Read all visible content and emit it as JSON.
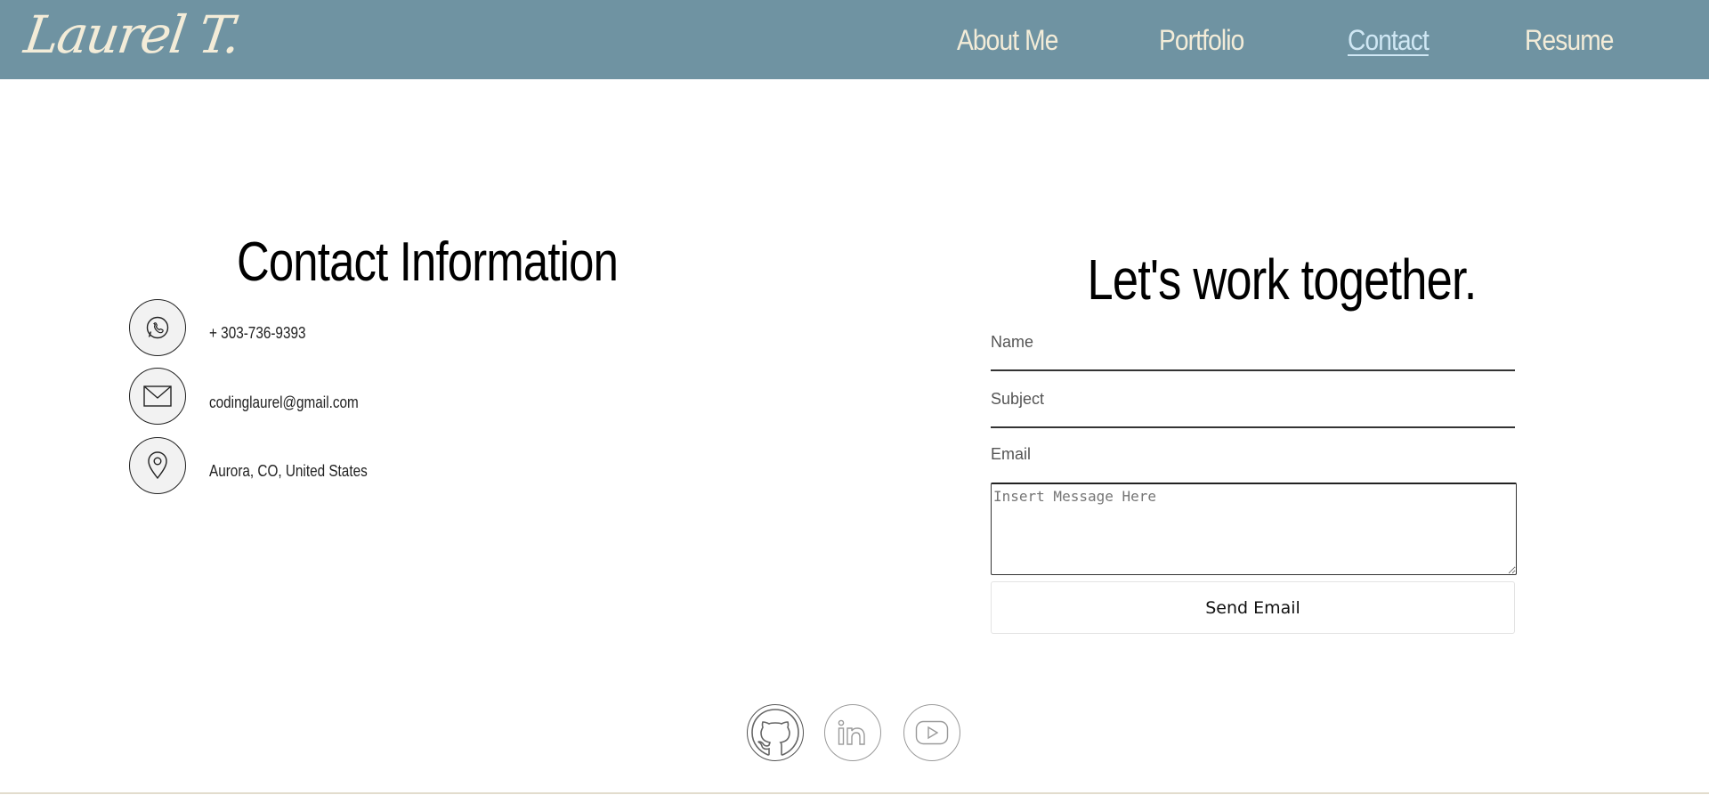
{
  "header": {
    "logo_text": "Laurel T.",
    "background_color": "#6f93a2",
    "text_color": "#f3ecd8",
    "active_color": "#cfe7f4",
    "nav": [
      {
        "label": "About Me",
        "active": false
      },
      {
        "label": "Portfolio",
        "active": false
      },
      {
        "label": "Contact",
        "active": true
      },
      {
        "label": "Resume",
        "active": false
      }
    ]
  },
  "contact_info": {
    "title": "Contact Information",
    "items": [
      {
        "icon": "whatsapp-icon",
        "text": "+ 303-736-9393"
      },
      {
        "icon": "mail-icon",
        "text": "codinglaurel@gmail.com"
      },
      {
        "icon": "location-pin-icon",
        "text": "Aurora, CO, United States"
      }
    ]
  },
  "form": {
    "title": "Let's work together.",
    "name_label": "Name",
    "subject_label": "Subject",
    "email_label": "Email",
    "message_placeholder": "Insert Message Here",
    "send_label": "Send Email"
  },
  "social": [
    {
      "icon": "github-icon"
    },
    {
      "icon": "linkedin-icon"
    },
    {
      "icon": "youtube-icon"
    }
  ]
}
